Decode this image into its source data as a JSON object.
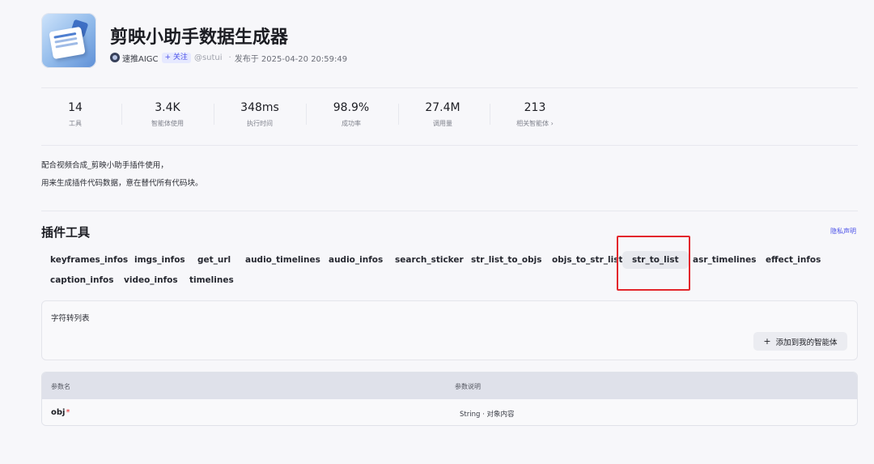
{
  "plugin": {
    "title": "剪映小助手数据生成器",
    "author": "速推AIGC",
    "follow_label": "+ 关注",
    "handle": "@sutui",
    "separator": "·",
    "published": "发布于 2025-04-20 20:59:49"
  },
  "stats": [
    {
      "value": "14",
      "label": "工具"
    },
    {
      "value": "3.4K",
      "label": "智能体使用"
    },
    {
      "value": "348ms",
      "label": "执行时间"
    },
    {
      "value": "98.9%",
      "label": "成功率"
    },
    {
      "value": "27.4M",
      "label": "调用量"
    },
    {
      "value": "213",
      "label": "相关智能体 ›"
    }
  ],
  "description": [
    "配合视频合成_剪映小助手插件使用，",
    "用来生成插件代码数据，意在替代所有代码块。"
  ],
  "tools_section": {
    "title": "插件工具",
    "privacy_link": "隐私声明",
    "tabs": [
      "keyframes_infos",
      "imgs_infos",
      "get_url",
      "audio_timelines",
      "audio_infos",
      "search_sticker",
      "str_list_to_objs",
      "objs_to_str_list",
      "str_to_list",
      "asr_timelines",
      "effect_infos",
      "caption_infos",
      "video_infos",
      "timelines"
    ],
    "active_tab": "str_to_list"
  },
  "tool_card": {
    "description": "字符转列表",
    "add_button_icon": "+",
    "add_button_label": "添加到我的智能体"
  },
  "params_table": {
    "headers": [
      "参数名",
      "参数说明"
    ],
    "rows": [
      {
        "name": "obj",
        "required_mark": "*",
        "description": "String · 对象内容"
      }
    ]
  },
  "colors": {
    "accent": "#4d53e8",
    "highlight_box": "#e3262c",
    "required": "#e3262c"
  }
}
